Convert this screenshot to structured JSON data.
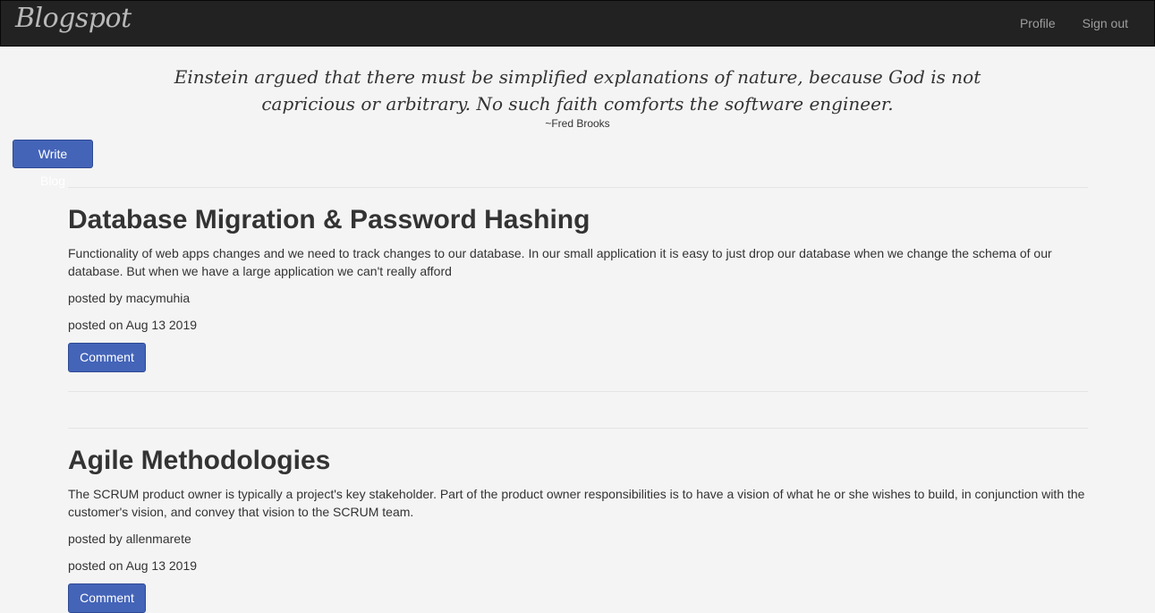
{
  "navbar": {
    "brand": "Blogspot",
    "links": [
      "Profile",
      "Sign out"
    ]
  },
  "quote": {
    "text": "Einstein argued that there must be simplified explanations of nature, because God is not capricious or arbitrary. No such faith comforts the software engineer.",
    "author": "~Fred Brooks"
  },
  "actions": {
    "write_blog": "Write Blog"
  },
  "posts": [
    {
      "title": "Database Migration & Password Hashing",
      "body": "Functionality of web apps changes and we need to track changes to our database. In our small application it is easy to just drop our database when we change the schema of our database. But when we have a large application we can't really afford",
      "author": "posted by macymuhia",
      "date": "posted on Aug 13 2019",
      "comment_label": "Comment"
    },
    {
      "title": "Agile Methodologies",
      "body": "The SCRUM product owner is typically a project's key stakeholder. Part of the product owner responsibilities is to have a vision of what he or she wishes to build, in conjunction with the customer's vision, and convey that vision to the SCRUM team.",
      "author": "posted by allenmarete",
      "date": "posted on Aug 13 2019",
      "comment_label": "Comment"
    }
  ],
  "colors": {
    "navbar_bg": "#222222",
    "page_bg": "#f4f4f4",
    "button_bg": "#4464b8",
    "nav_link": "#9d9d9d"
  }
}
